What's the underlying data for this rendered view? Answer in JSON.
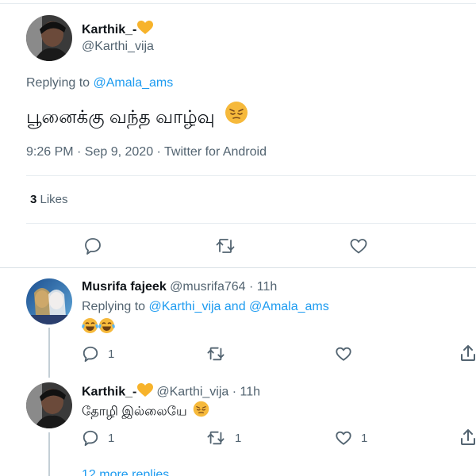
{
  "main_tweet": {
    "display_name": "Karthik_-",
    "handle": "@Karthi_vija",
    "replying_prefix": "Replying to ",
    "replying_to": "@Amala_ams",
    "text": "பூனைக்கு வந்த வாழ்வு",
    "timestamp": "9:26 PM · Sep 9, 2020 · Twitter for Android",
    "likes_count": "3",
    "likes_label": " Likes"
  },
  "reply1": {
    "display_name": "Musrifa fajeek",
    "handle": "@musrifa764",
    "time": "· 11h",
    "replying_prefix": "Replying to ",
    "replying_to": "@Karthi_vija and @Amala_ams",
    "reply_count": "1",
    "retweet_count": "",
    "like_count": ""
  },
  "reply2": {
    "display_name": "Karthik_-",
    "handle": "@Karthi_vija",
    "time": "· 11h",
    "text": "தோழி இல்லையே",
    "reply_count": "1",
    "retweet_count": "1",
    "like_count": "1"
  },
  "more_replies": "12 more replies",
  "icons": [
    "heart-emoji",
    "pensive-emoji",
    "tears-of-joy-emoji",
    "reply-icon",
    "retweet-icon",
    "like-icon",
    "share-icon"
  ],
  "colors": {
    "link": "#1d9bf0",
    "muted": "#536471",
    "heart_emoji": "#f7b32b",
    "emoji_face": "#f6b93b"
  }
}
